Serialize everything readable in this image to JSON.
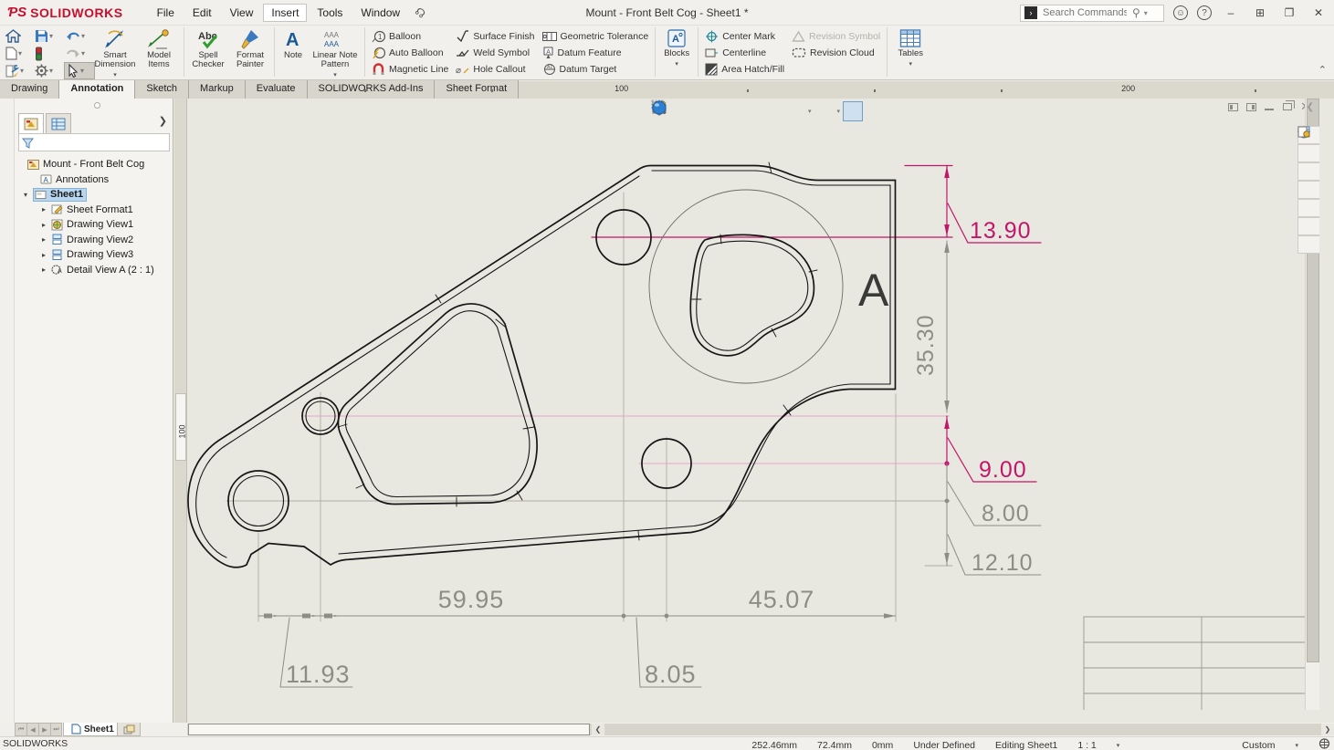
{
  "title_bar": {
    "logo": "SOLIDWORKS",
    "menus": [
      "File",
      "Edit",
      "View",
      "Insert",
      "Tools",
      "Window"
    ],
    "document_title": "Mount - Front Belt Cog - Sheet1 *",
    "search_placeholder": "Search Commands"
  },
  "ribbon": {
    "smart_dimension": "Smart Dimension",
    "model_items": "Model Items",
    "spell_checker": "Spell Checker",
    "format_painter": "Format Painter",
    "note": "Note",
    "linear_note_pattern": "Linear Note Pattern",
    "balloon": "Balloon",
    "auto_balloon": "Auto Balloon",
    "magnetic_line": "Magnetic Line",
    "surface_finish": "Surface Finish",
    "weld_symbol": "Weld Symbol",
    "hole_callout": "Hole Callout",
    "geometric_tolerance": "Geometric Tolerance",
    "datum_feature": "Datum Feature",
    "datum_target": "Datum Target",
    "blocks": "Blocks",
    "center_mark": "Center Mark",
    "centerline": "Centerline",
    "area_hatch": "Area Hatch/Fill",
    "revision_symbol": "Revision Symbol",
    "revision_cloud": "Revision Cloud",
    "tables": "Tables"
  },
  "command_tabs": [
    "Drawing",
    "Annotation",
    "Sketch",
    "Markup",
    "Evaluate",
    "SOLIDWORKS Add-Ins",
    "Sheet Format"
  ],
  "ruler": {
    "h1": "100",
    "h2": "200",
    "v": "100"
  },
  "tree": {
    "root": "Mount - Front Belt Cog",
    "annotations": "Annotations",
    "sheet": "Sheet1",
    "children": [
      "Sheet Format1",
      "Drawing View1",
      "Drawing View2",
      "Drawing View3",
      "Detail View A (2 : 1)"
    ]
  },
  "drawing": {
    "detail_label": "A",
    "dim_13_90": "13.90",
    "dim_35_30": "35.30",
    "dim_9_00": "9.00",
    "dim_8_00": "8.00",
    "dim_12_10": "12.10",
    "dim_59_95": "59.95",
    "dim_45_07": "45.07",
    "dim_11_93": "11.93",
    "dim_8_05": "8.05",
    "colors": {
      "selected": "#c2156b",
      "dim_gray": "#8d8d86",
      "ref_pink": "#e2a6c6",
      "line": "#161616"
    }
  },
  "sheet_tabs": {
    "sheet1": "Sheet1"
  },
  "status_bar": {
    "app": "SOLIDWORKS",
    "x": "252.46mm",
    "y": "72.4mm",
    "z": "0mm",
    "state": "Under Defined",
    "editing": "Editing Sheet1",
    "scale": "1 : 1",
    "units": "Custom"
  }
}
